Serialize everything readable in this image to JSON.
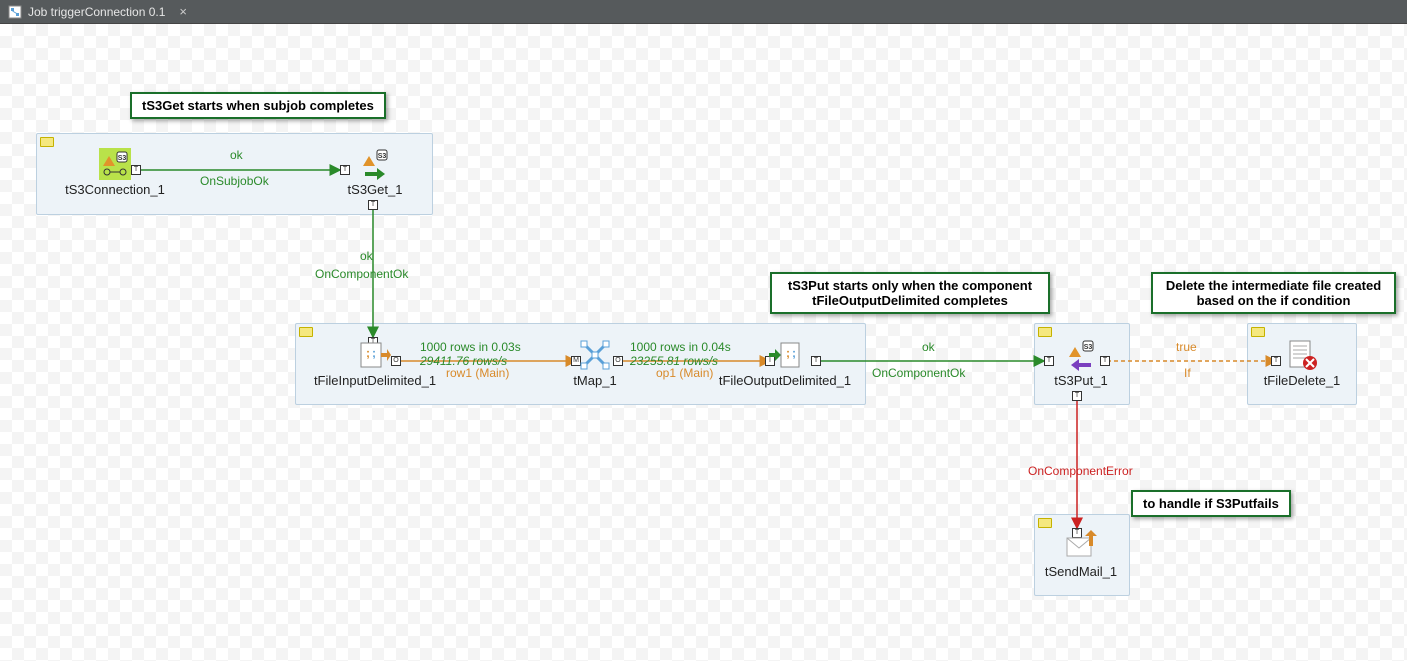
{
  "tab": {
    "title": "Job triggerConnection 0.1"
  },
  "notes": {
    "n1": "tS3Get starts when subjob completes",
    "n2": "tS3Put starts only when the component tFileOutputDelimited  completes",
    "n3": "Delete the intermediate file created based on the if condition",
    "n4": "to handle if S3Putfails"
  },
  "components": {
    "tS3Connection_1": "tS3Connection_1",
    "tS3Get_1": "tS3Get_1",
    "tFileInputDelimited_1": "tFileInputDelimited_1",
    "tMap_1": "tMap_1",
    "tFileOutputDelimited_1": "tFileOutputDelimited_1",
    "tS3Put_1": "tS3Put_1",
    "tFileDelete_1": "tFileDelete_1",
    "tSendMail_1": "tSendMail_1"
  },
  "links": {
    "l1_ok": "ok",
    "l1_name": "OnSubjobOk",
    "l2_ok": "ok",
    "l2_name": "OnComponentOk",
    "l3_stats": "1000 rows in 0.03s",
    "l3_rate": "29411.76 rows/s",
    "l3_name": "row1 (Main)",
    "l4_stats": "1000 rows in 0.04s",
    "l4_rate": "23255.81 rows/s",
    "l4_name": "op1 (Main)",
    "l5_ok": "ok",
    "l5_name": "OnComponentOk",
    "l6_true": "true",
    "l6_name": "If",
    "l7_name": "OnComponentError"
  }
}
